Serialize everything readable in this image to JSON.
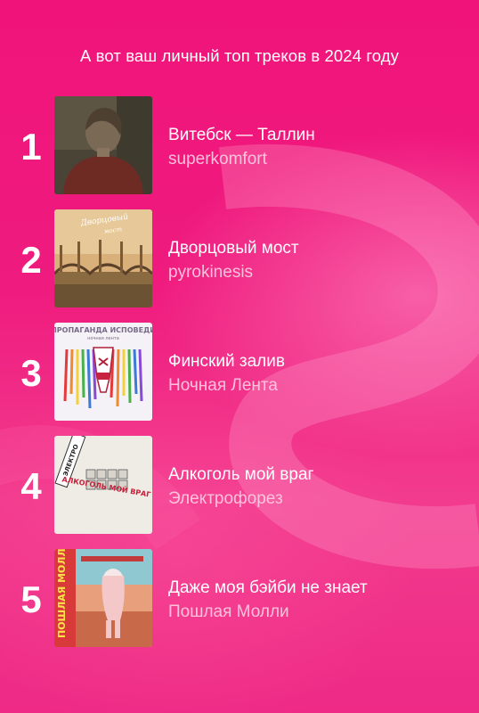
{
  "header": {
    "title": "А вот ваш личный топ треков в 2024 году"
  },
  "tracks": [
    {
      "rank": "1",
      "title": "Витебск — Таллин",
      "artist": "superkomfort"
    },
    {
      "rank": "2",
      "title": "Дворцовый мост",
      "artist": "pyrokinesis",
      "cover_text": "Дворцовый мост"
    },
    {
      "rank": "3",
      "title": "Финский залив",
      "artist": "Ночная Лента",
      "cover_text": "ПРОПАГАНДА ИСПОВЕДИ",
      "cover_subtext": "ночная лента"
    },
    {
      "rank": "4",
      "title": "Алкоголь мой враг",
      "artist": "Электрофорез",
      "cover_text": "АЛКОГОЛЬ МОЙ ВРАГ"
    },
    {
      "rank": "5",
      "title": "Даже моя бэйби не знает",
      "artist": "Пошлая Молли",
      "cover_text": "ПОШЛАЯ МОЛЛИ"
    }
  ],
  "colors": {
    "background": "#f0147a",
    "text": "#ffffff",
    "artist_text": "#ffcde2"
  }
}
